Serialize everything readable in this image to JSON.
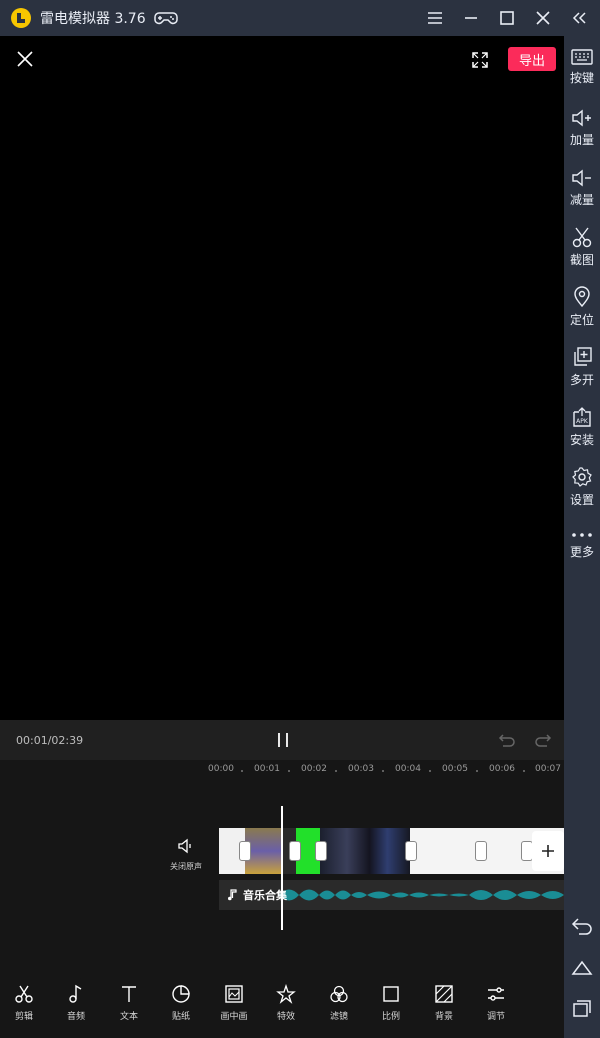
{
  "window": {
    "title": "雷电模拟器 3.76"
  },
  "preview": {
    "export_label": "导出"
  },
  "playback": {
    "timecode": "00:01/02:39"
  },
  "timeline": {
    "ticks": [
      "00:00",
      "00:01",
      "00:02",
      "00:03",
      "00:04",
      "00:05",
      "00:06",
      "00:07"
    ],
    "mute_label": "关闭原声",
    "audio_label": "音乐合集"
  },
  "toolbar": {
    "items": [
      {
        "label": "剪辑",
        "icon": "scissors-icon"
      },
      {
        "label": "音频",
        "icon": "music-note-icon"
      },
      {
        "label": "文本",
        "icon": "text-icon"
      },
      {
        "label": "贴纸",
        "icon": "sticker-icon"
      },
      {
        "label": "画中画",
        "icon": "picture-in-picture-icon"
      },
      {
        "label": "特效",
        "icon": "effects-star-icon"
      },
      {
        "label": "滤镜",
        "icon": "filter-icon"
      },
      {
        "label": "比例",
        "icon": "ratio-icon"
      },
      {
        "label": "背景",
        "icon": "background-icon"
      },
      {
        "label": "调节",
        "icon": "adjust-icon"
      }
    ]
  },
  "sidebar": {
    "items": [
      {
        "label": "按键",
        "icon": "keyboard-icon"
      },
      {
        "label": "加量",
        "icon": "volume-up-icon"
      },
      {
        "label": "减量",
        "icon": "volume-down-icon"
      },
      {
        "label": "截图",
        "icon": "screenshot-scissors-icon"
      },
      {
        "label": "定位",
        "icon": "location-pin-icon"
      },
      {
        "label": "多开",
        "icon": "multi-instance-icon"
      },
      {
        "label": "安装",
        "icon": "apk-install-icon"
      },
      {
        "label": "设置",
        "icon": "gear-icon"
      },
      {
        "label": "更多",
        "icon": "more-dots-icon"
      }
    ]
  },
  "colors": {
    "chrome": "#2b3240",
    "accent": "#fb2b5a",
    "audio_wave": "#1a8d95"
  }
}
